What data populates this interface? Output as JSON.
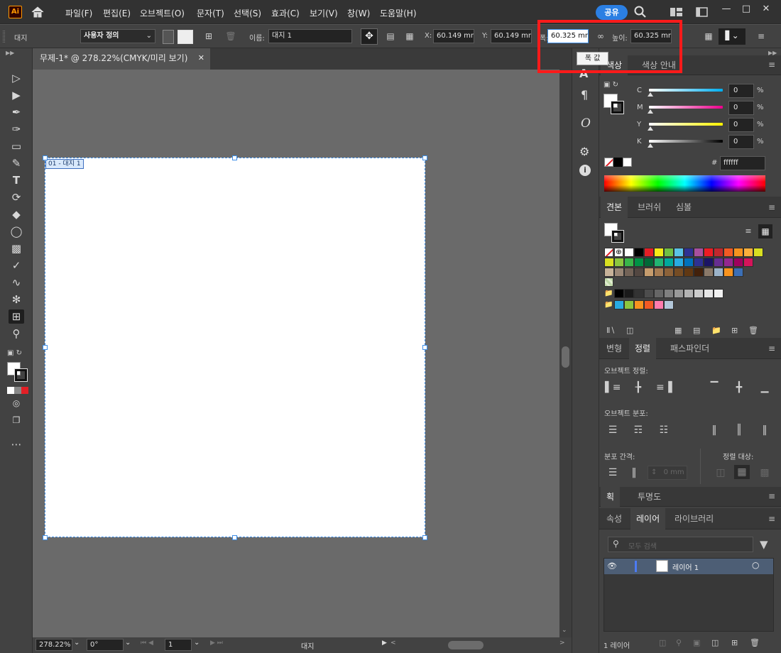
{
  "app": {
    "logo": "Ai"
  },
  "menu": [
    "파일(F)",
    "편집(E)",
    "오브젝트(O)",
    "문자(T)",
    "선택(S)",
    "효과(C)",
    "보기(V)",
    "창(W)",
    "도움말(H)"
  ],
  "share": "공유",
  "control": {
    "selection_label": "대지",
    "preset": "사용자 정의",
    "name_label": "이름:",
    "name_value": "대지 1",
    "x_label": "X:",
    "x_value": "60.149 mm",
    "y_label": "Y:",
    "y_value": "60.149 mm",
    "w_label": "폭:",
    "w_value": "60.325 mm",
    "h_label": "높이:",
    "h_value": "60.325 mm",
    "tooltip": "폭 값"
  },
  "document": {
    "tab_title": "무제-1* @ 278.22%(CMYK/미리 보기)",
    "artboard_label": "01 - 대지 1"
  },
  "status": {
    "zoom": "278.22%",
    "rotation": "0°",
    "artboard_num": "1",
    "tool": "대지"
  },
  "color_panel": {
    "tabs": [
      "색상",
      "색상 안내"
    ],
    "channels": [
      {
        "name": "C",
        "value": "0",
        "unit": "%"
      },
      {
        "name": "M",
        "value": "0",
        "unit": "%"
      },
      {
        "name": "Y",
        "value": "0",
        "unit": "%"
      },
      {
        "name": "K",
        "value": "0",
        "unit": "%"
      }
    ],
    "hex_label": "#",
    "hex": "ffffff"
  },
  "swatch_panel": {
    "tabs": [
      "견본",
      "브러쉬",
      "심볼"
    ]
  },
  "align_panel": {
    "tabs": [
      "변형",
      "정렬",
      "패스파인더"
    ],
    "align_objects": "오브젝트 정렬:",
    "distribute_objects": "오브젝트 분포:",
    "distribute_spacing": "분포 간격:",
    "align_to": "정렬 대상:",
    "spacing_value": "0 mm"
  },
  "stroke_panel": {
    "tabs": [
      "획",
      "투명도"
    ]
  },
  "layers_panel": {
    "tabs": [
      "속성",
      "레이어",
      "라이브러리"
    ],
    "search_placeholder": "모두 검색",
    "layer_name": "레이어 1",
    "footer": "1 레이어"
  },
  "swatch_colors": {
    "row1": [
      "#ffffff",
      "#000000",
      "#e31f26",
      "#f6eb16",
      "#71bf44",
      "#5bc2e7",
      "#2e3192",
      "#a84f9e",
      "#ed1c24",
      "#c1272d",
      "#f15a24",
      "#f7931e",
      "#fbb03b",
      "#d9e021"
    ],
    "row2": [
      "#d9e021",
      "#8cc63f",
      "#39b54a",
      "#009245",
      "#006837",
      "#22b573",
      "#00a99d",
      "#29abe2",
      "#0071bc",
      "#2e3192",
      "#1b1464",
      "#662d91",
      "#93278f",
      "#9e005d",
      "#d4145a"
    ],
    "row3": [
      "#c7b299",
      "#998675",
      "#736357",
      "#534741",
      "#c69c6d",
      "#a67c52",
      "#8c6239",
      "#754c24",
      "#603813",
      "#42210b",
      "#8a7969",
      "#9bb3c9",
      "#f7931e",
      "#3b6fb6"
    ],
    "row4": [
      "#000000",
      "#1a1a1a",
      "#333333",
      "#4d4d4d",
      "#666666",
      "#808080",
      "#999999",
      "#b3b3b3",
      "#cccccc",
      "#e6e6e6",
      "#f2f2f2"
    ],
    "row5": [
      "#29abe2",
      "#8cc63f",
      "#f7931e",
      "#f15a24",
      "#ff7bac",
      "#b3c7d9"
    ]
  }
}
